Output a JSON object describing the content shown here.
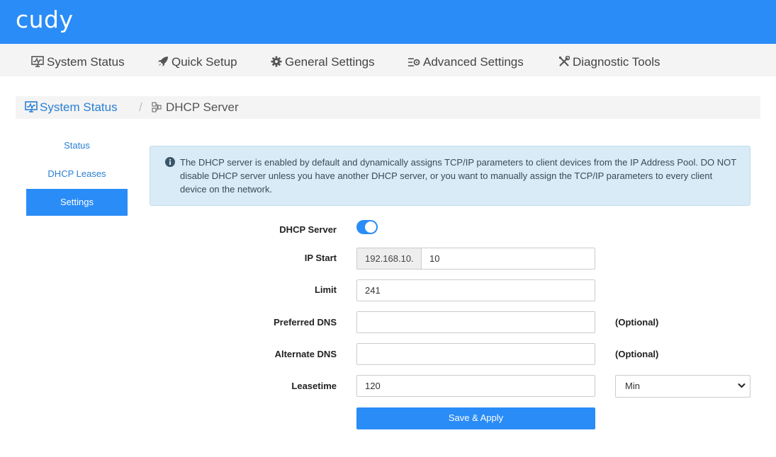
{
  "brand": {
    "logo_text": "cudy",
    "primary_color": "#2a8cf7"
  },
  "nav": {
    "items": [
      {
        "label": "System Status",
        "icon": "monitor-icon"
      },
      {
        "label": "Quick Setup",
        "icon": "rocket-icon"
      },
      {
        "label": "General Settings",
        "icon": "gear-icon"
      },
      {
        "label": "Advanced Settings",
        "icon": "advanced-settings-icon"
      },
      {
        "label": "Diagnostic Tools",
        "icon": "tools-icon"
      }
    ]
  },
  "breadcrumb": {
    "parent": "System Status",
    "separator": "/",
    "current": "DHCP Server"
  },
  "sidebar": {
    "items": [
      {
        "label": "Status",
        "active": false
      },
      {
        "label": "DHCP Leases",
        "active": false
      },
      {
        "label": "Settings",
        "active": true
      }
    ]
  },
  "alert": {
    "icon": "info-icon",
    "text": "The DHCP server is enabled by default and dynamically assigns TCP/IP parameters to client devices from the IP Address Pool. DO NOT disable DHCP server unless you have another DHCP server, or you want to manually assign the TCP/IP parameters to every client device on the network."
  },
  "form": {
    "dhcp_server": {
      "label": "DHCP Server",
      "enabled": true
    },
    "ip_start": {
      "label": "IP Start",
      "prefix": "192.168.10.",
      "value": "10"
    },
    "limit": {
      "label": "Limit",
      "value": "241"
    },
    "preferred_dns": {
      "label": "Preferred DNS",
      "value": "",
      "note": "(Optional)"
    },
    "alternate_dns": {
      "label": "Alternate DNS",
      "value": "",
      "note": "(Optional)"
    },
    "leasetime": {
      "label": "Leasetime",
      "value": "120",
      "unit": "Min"
    },
    "save_label": "Save & Apply"
  }
}
